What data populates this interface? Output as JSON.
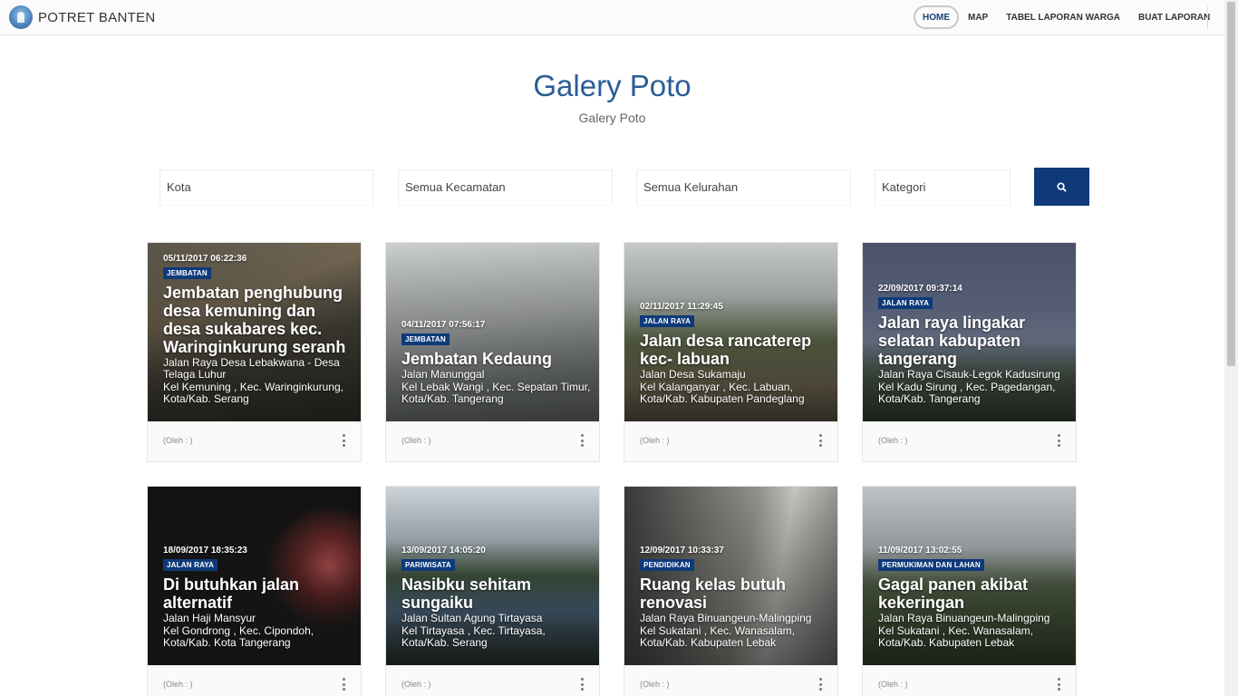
{
  "header": {
    "brand": "POTRET BANTEN",
    "nav": [
      "HOME",
      "MAP",
      "TABEL LAPORAN WARGA",
      "BUAT LAPORAN"
    ]
  },
  "page": {
    "title": "Galery Poto",
    "subtitle": "Galery Poto"
  },
  "filters": {
    "kota": "Kota",
    "kecamatan": "Semua Kecamatan",
    "kelurahan": "Semua Kelurahan",
    "kategori": "Kategori"
  },
  "cards": [
    {
      "date": "05/11/2017 06:22:36",
      "category": "JEMBATAN",
      "title": "Jembatan penghubung desa kemuning dan desa sukabares kec. Waringinkurung seranh",
      "street": "Jalan Raya Desa Lebakwana - Desa Telaga Luhur",
      "area": "Kel Kemuning , Kec. Waringinkurung, Kota/Kab. Serang",
      "author": "(Oleh : )"
    },
    {
      "date": "04/11/2017 07:56:17",
      "category": "JEMBATAN",
      "title": "Jembatan Kedaung",
      "street": "Jalan Manunggal",
      "area": "Kel Lebak Wangi , Kec. Sepatan Timur, Kota/Kab. Tangerang",
      "author": "(Oleh : )"
    },
    {
      "date": "02/11/2017 11:29:45",
      "category": "JALAN RAYA",
      "title": "Jalan desa rancaterep kec- labuan",
      "street": "Jalan Desa Sukamaju",
      "area": "Kel Kalanganyar , Kec. Labuan, Kota/Kab. Kabupaten Pandeglang",
      "author": "(Oleh : )"
    },
    {
      "date": "22/09/2017 09:37:14",
      "category": "JALAN RAYA",
      "title": "Jalan raya lingakar selatan kabupaten tangerang",
      "street": "Jalan Raya Cisauk-Legok Kadusirung",
      "area": "Kel Kadu Sirung , Kec. Pagedangan, Kota/Kab. Tangerang",
      "author": "(Oleh : )"
    },
    {
      "date": "18/09/2017 18:35:23",
      "category": "JALAN RAYA",
      "title": "Di butuhkan jalan alternatif",
      "street": "Jalan Haji Mansyur",
      "area": "Kel Gondrong , Kec. Cipondoh, Kota/Kab. Kota Tangerang",
      "author": "(Oleh : )"
    },
    {
      "date": "13/09/2017 14:05:20",
      "category": "PARIWISATA",
      "title": "Nasibku sehitam sungaiku",
      "street": "Jalan Sultan Agung Tirtayasa",
      "area": "Kel Tirtayasa , Kec. Tirtayasa, Kota/Kab. Serang",
      "author": "(Oleh : )"
    },
    {
      "date": "12/09/2017 10:33:37",
      "category": "PENDIDIKAN",
      "title": "Ruang kelas butuh renovasi",
      "street": "Jalan Raya Binuangeun-Malingping",
      "area": "Kel Sukatani , Kec. Wanasalam, Kota/Kab. Kabupaten Lebak",
      "author": "(Oleh : )"
    },
    {
      "date": "11/09/2017 13:02:55",
      "category": "PERMUKIMAN DAN LAHAN",
      "title": "Gagal panen akibat kekeringan",
      "street": "Jalan Raya Binuangeun-Malingping",
      "area": "Kel Sukatani , Kec. Wanasalam, Kota/Kab. Kabupaten Lebak",
      "author": "(Oleh : )"
    }
  ]
}
